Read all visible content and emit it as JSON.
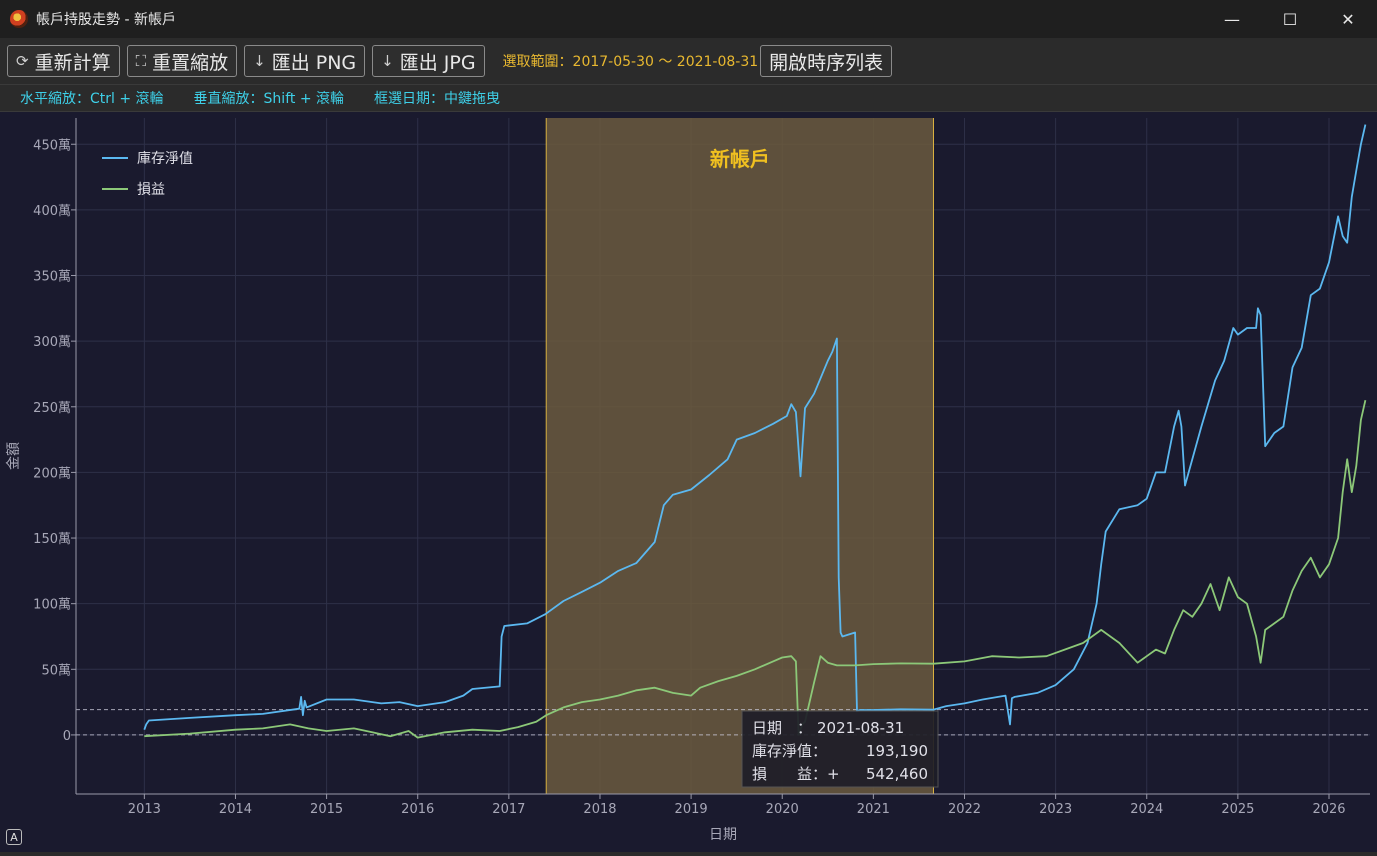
{
  "window": {
    "title": "帳戶持股走勢 - 新帳戶",
    "controls": [
      "—",
      "☐",
      "✕"
    ]
  },
  "toolbar": {
    "recalc_label": "重新計算",
    "reset_zoom_label": "重置縮放",
    "export_png_label": "匯出 PNG",
    "export_jpg_label": "匯出 JPG",
    "range_label": "選取範圍：2017-05-30 ～ 2021-08-31",
    "open_table_label": "開啟時序列表"
  },
  "hints": [
    "水平縮放：Ctrl + 滾輪",
    "垂直縮放：Shift + 滾輪",
    "框選日期：中鍵拖曳"
  ],
  "colors": {
    "net_value": "#5bb8f0",
    "pnl": "#8cc878",
    "highlight": "#6b5a3e",
    "highlight_border": "#d8b040",
    "highlight_label": "#f0c020",
    "plot_bg": "#1a1a2e"
  },
  "chart_data": {
    "type": "line",
    "xlabel": "日期",
    "ylabel": "金額",
    "xlim": [
      2012.25,
      2026.45
    ],
    "ylim": [
      -450000,
      4700000
    ],
    "x_ticks": [
      "2013",
      "2014",
      "2015",
      "2016",
      "2017",
      "2018",
      "2019",
      "2020",
      "2021",
      "2022",
      "2023",
      "2024",
      "2025",
      "2026"
    ],
    "y_ticks": [
      {
        "value": 0,
        "label": "0"
      },
      {
        "value": 500000,
        "label": "50萬"
      },
      {
        "value": 1000000,
        "label": "100萬"
      },
      {
        "value": 1500000,
        "label": "150萬"
      },
      {
        "value": 2000000,
        "label": "200萬"
      },
      {
        "value": 2500000,
        "label": "250萬"
      },
      {
        "value": 3000000,
        "label": "300萬"
      },
      {
        "value": 3500000,
        "label": "350萬"
      },
      {
        "value": 4000000,
        "label": "400萬"
      },
      {
        "value": 4500000,
        "label": "450萬"
      }
    ],
    "grid": true,
    "legend_position": "top-left",
    "highlight_range": {
      "start": 2017.41,
      "end": 2021.66,
      "label": "新帳戶"
    },
    "reference_lines": [
      0,
      193190
    ],
    "series": [
      {
        "name": "庫存淨值",
        "color": "#5bb8f0",
        "x": [
          2013.0,
          2013.02,
          2013.05,
          2013.5,
          2014.0,
          2014.3,
          2014.7,
          2014.72,
          2014.74,
          2014.76,
          2014.78,
          2015.0,
          2015.3,
          2015.6,
          2015.8,
          2016.0,
          2016.3,
          2016.5,
          2016.6,
          2016.9,
          2016.92,
          2016.95,
          2017.2,
          2017.4,
          2017.6,
          2017.8,
          2018.0,
          2018.2,
          2018.4,
          2018.6,
          2018.7,
          2018.8,
          2019.0,
          2019.2,
          2019.4,
          2019.5,
          2019.7,
          2019.9,
          2020.05,
          2020.1,
          2020.15,
          2020.2,
          2020.25,
          2020.35,
          2020.5,
          2020.55,
          2020.6,
          2020.62,
          2020.64,
          2020.66,
          2020.8,
          2020.82,
          2020.85,
          2021.0,
          2021.3,
          2021.66,
          2021.8,
          2022.0,
          2022.2,
          2022.45,
          2022.5,
          2022.52,
          2022.55,
          2022.8,
          2023.0,
          2023.2,
          2023.35,
          2023.45,
          2023.5,
          2023.55,
          2023.7,
          2023.9,
          2024.0,
          2024.1,
          2024.2,
          2024.3,
          2024.35,
          2024.38,
          2024.42,
          2024.5,
          2024.6,
          2024.75,
          2024.85,
          2024.95,
          2025.0,
          2025.1,
          2025.2,
          2025.22,
          2025.25,
          2025.3,
          2025.4,
          2025.5,
          2025.6,
          2025.7,
          2025.8,
          2025.9,
          2026.0,
          2026.1,
          2026.15,
          2026.2,
          2026.25,
          2026.3,
          2026.35,
          2026.4
        ],
        "values": [
          40000,
          80000,
          110000,
          130000,
          150000,
          160000,
          200000,
          290000,
          150000,
          260000,
          210000,
          270000,
          270000,
          240000,
          250000,
          220000,
          250000,
          300000,
          350000,
          370000,
          750000,
          830000,
          850000,
          920000,
          1020000,
          1090000,
          1160000,
          1250000,
          1310000,
          1470000,
          1750000,
          1830000,
          1870000,
          1980000,
          2100000,
          2250000,
          2300000,
          2370000,
          2430000,
          2520000,
          2460000,
          1970000,
          2490000,
          2600000,
          2850000,
          2920000,
          3020000,
          1200000,
          780000,
          750000,
          780000,
          180000,
          190000,
          190000,
          195000,
          193190,
          220000,
          240000,
          270000,
          300000,
          80000,
          280000,
          290000,
          320000,
          380000,
          500000,
          700000,
          1000000,
          1300000,
          1550000,
          1720000,
          1750000,
          1800000,
          2000000,
          2000000,
          2350000,
          2470000,
          2350000,
          1900000,
          2100000,
          2350000,
          2700000,
          2850000,
          3100000,
          3050000,
          3100000,
          3100000,
          3250000,
          3200000,
          2200000,
          2300000,
          2350000,
          2800000,
          2950000,
          3350000,
          3400000,
          3600000,
          3950000,
          3800000,
          3750000,
          4100000,
          4300000,
          4500000,
          4650000
        ]
      },
      {
        "name": "損益",
        "color": "#8cc878",
        "x": [
          2013.0,
          2013.5,
          2014.0,
          2014.3,
          2014.6,
          2014.8,
          2015.0,
          2015.3,
          2015.5,
          2015.7,
          2015.9,
          2016.0,
          2016.3,
          2016.6,
          2016.9,
          2017.1,
          2017.3,
          2017.41,
          2017.6,
          2017.8,
          2018.0,
          2018.2,
          2018.4,
          2018.6,
          2018.8,
          2019.0,
          2019.1,
          2019.3,
          2019.5,
          2019.7,
          2019.9,
          2020.0,
          2020.1,
          2020.15,
          2020.18,
          2020.22,
          2020.25,
          2020.35,
          2020.42,
          2020.5,
          2020.6,
          2020.8,
          2021.0,
          2021.3,
          2021.66,
          2022.0,
          2022.3,
          2022.6,
          2022.9,
          2023.1,
          2023.3,
          2023.5,
          2023.7,
          2023.9,
          2024.0,
          2024.1,
          2024.2,
          2024.3,
          2024.4,
          2024.5,
          2024.6,
          2024.7,
          2024.8,
          2024.9,
          2025.0,
          2025.1,
          2025.2,
          2025.25,
          2025.3,
          2025.4,
          2025.5,
          2025.6,
          2025.7,
          2025.8,
          2025.9,
          2026.0,
          2026.1,
          2026.15,
          2026.2,
          2026.25,
          2026.3,
          2026.35,
          2026.4
        ],
        "values": [
          -10000,
          10000,
          40000,
          50000,
          80000,
          50000,
          30000,
          50000,
          20000,
          -10000,
          30000,
          -20000,
          20000,
          40000,
          30000,
          60000,
          100000,
          150000,
          210000,
          250000,
          270000,
          300000,
          340000,
          360000,
          320000,
          300000,
          360000,
          410000,
          450000,
          500000,
          560000,
          590000,
          600000,
          560000,
          0,
          80000,
          100000,
          400000,
          600000,
          550000,
          530000,
          530000,
          540000,
          545000,
          542460,
          560000,
          600000,
          590000,
          600000,
          650000,
          700000,
          800000,
          700000,
          550000,
          600000,
          650000,
          620000,
          800000,
          950000,
          900000,
          1000000,
          1150000,
          950000,
          1200000,
          1050000,
          1000000,
          750000,
          550000,
          800000,
          850000,
          900000,
          1100000,
          1250000,
          1350000,
          1200000,
          1300000,
          1500000,
          1850000,
          2100000,
          1850000,
          2050000,
          2400000,
          2550000
        ]
      }
    ],
    "tooltip": {
      "date_label": "日期　：",
      "date_value": "2021-08-31",
      "net_label": "庫存淨值：",
      "net_value": "193,190",
      "pnl_label": "損　　益：+",
      "pnl_value": "542,460"
    }
  }
}
